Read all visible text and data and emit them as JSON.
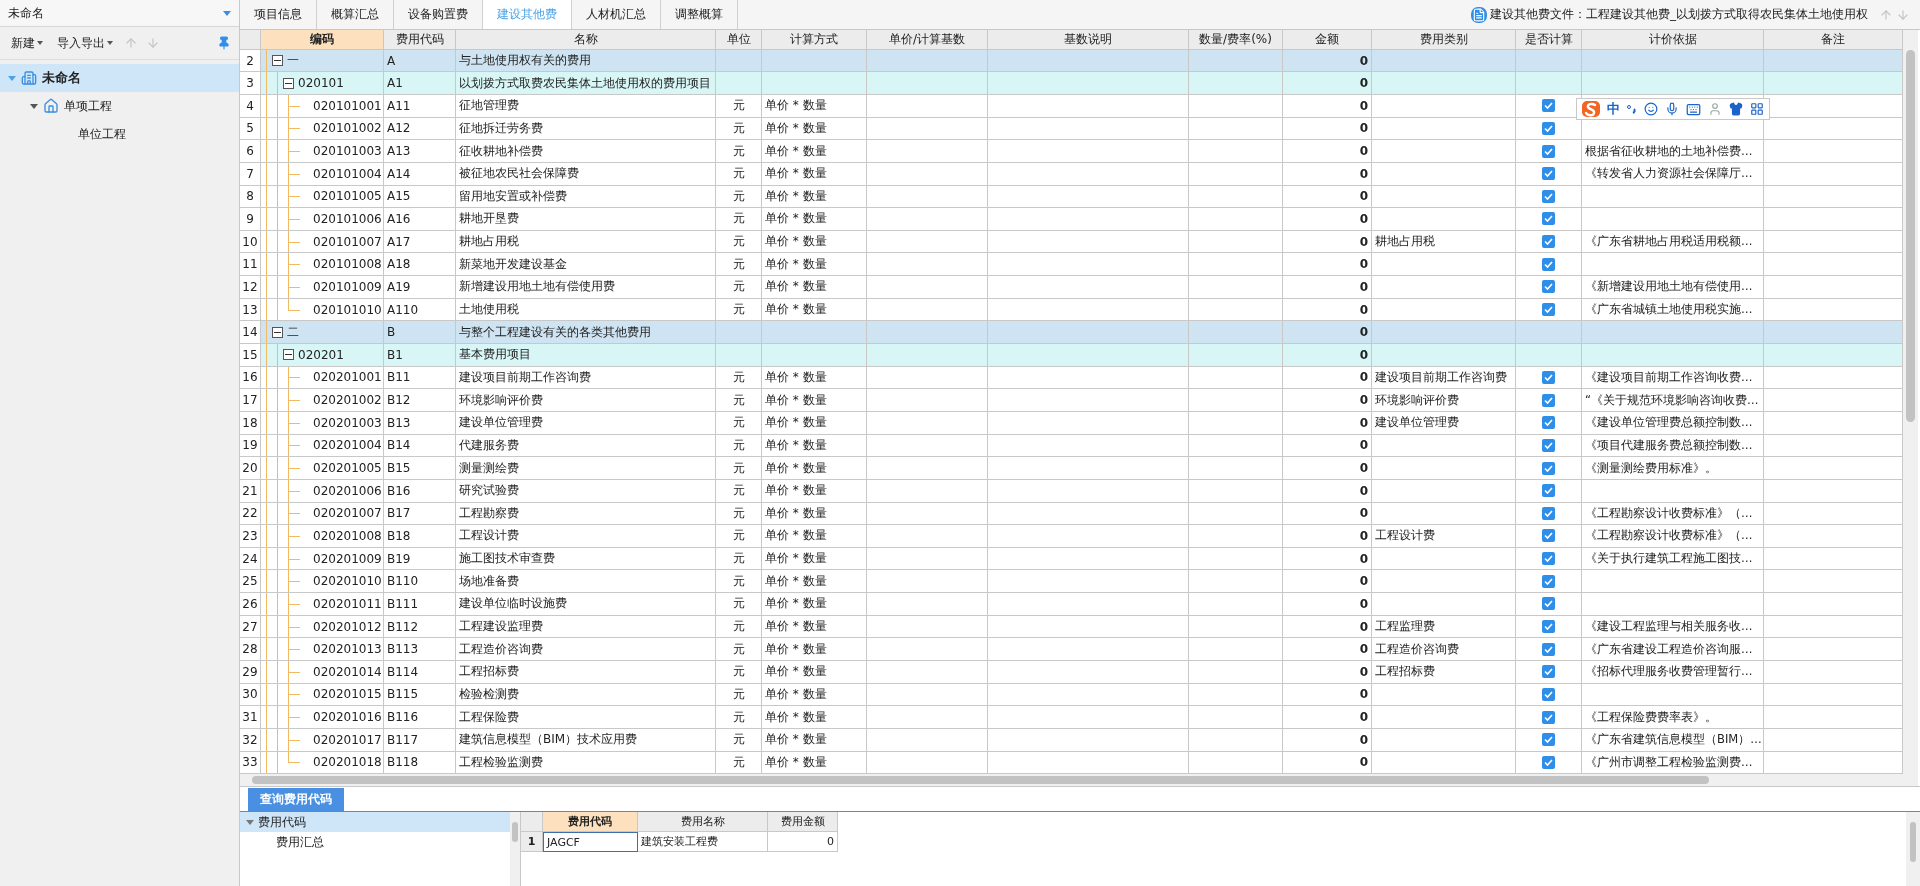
{
  "sidebar": {
    "title": "未命名",
    "toolbar": [
      {
        "label": "新建",
        "kind": "menu"
      },
      {
        "label": "导入导出",
        "kind": "menu"
      }
    ],
    "tree": [
      {
        "label": "未命名",
        "kind": "project",
        "selected": true,
        "expanded": true,
        "children": [
          {
            "label": "单项工程",
            "kind": "single",
            "selected": false,
            "expanded": true,
            "children": [
              {
                "label": "单位工程",
                "selected": false
              }
            ]
          }
        ]
      }
    ]
  },
  "tabs": [
    {
      "label": "项目信息",
      "selected": false
    },
    {
      "label": "概算汇总",
      "selected": false
    },
    {
      "label": "设备购置费",
      "selected": false
    },
    {
      "label": "建设其他费",
      "selected": true
    },
    {
      "label": "人材机汇总",
      "selected": false
    },
    {
      "label": "调整概算",
      "selected": false
    }
  ],
  "file_info": "建设其他费文件：工程建设其他费_以划拨方式取得农民集体土地使用权",
  "table": {
    "columns": [
      {
        "label": "编码",
        "selected": true
      },
      {
        "label": "费用代码",
        "selected": false
      },
      {
        "label": "名称",
        "selected": false
      },
      {
        "label": "单位",
        "selected": false
      },
      {
        "label": "计算方式",
        "selected": false
      },
      {
        "label": "单价/计算基数",
        "selected": false
      },
      {
        "label": "基数说明",
        "selected": false
      },
      {
        "label": "数量/费率(%)",
        "selected": false
      },
      {
        "label": "金额",
        "selected": false
      },
      {
        "label": "费用类别",
        "selected": false
      },
      {
        "label": "是否计算",
        "selected": false
      },
      {
        "label": "计价依据",
        "selected": false
      },
      {
        "label": "备注",
        "selected": false
      }
    ],
    "rows": [
      {
        "kind": "group",
        "no": "2",
        "code": "一",
        "fee_code": "A",
        "name": "与土地使用权有关的费用",
        "amount": "0",
        "expanded": true,
        "children": [
          {
            "kind": "subgroup",
            "no": "3",
            "code": "020101",
            "fee_code": "A1",
            "name": "以划拨方式取费农民集体土地使用权的费用项目",
            "amount": "0",
            "expanded": true,
            "children": [
              {
                "kind": "item",
                "no": "4",
                "code": "020101001",
                "fee_code": "A11",
                "name": "征地管理费",
                "unit": "元",
                "method": "单价 * 数量",
                "amount": "0",
                "checked": true
              },
              {
                "kind": "item",
                "no": "5",
                "code": "020101002",
                "fee_code": "A12",
                "name": "征地拆迁劳务费",
                "unit": "元",
                "method": "单价 * 数量",
                "amount": "0",
                "checked": true
              },
              {
                "kind": "item",
                "no": "6",
                "code": "020101003",
                "fee_code": "A13",
                "name": "征收耕地补偿费",
                "unit": "元",
                "method": "单价 * 数量",
                "amount": "0",
                "checked": true,
                "basis": "根据省征收耕地的土地补偿费…"
              },
              {
                "kind": "item",
                "no": "7",
                "code": "020101004",
                "fee_code": "A14",
                "name": "被征地农民社会保障费",
                "unit": "元",
                "method": "单价 * 数量",
                "amount": "0",
                "checked": true,
                "basis": "《转发省人力资源社会保障厅…"
              },
              {
                "kind": "item",
                "no": "8",
                "code": "020101005",
                "fee_code": "A15",
                "name": "留用地安置或补偿费",
                "unit": "元",
                "method": "单价 * 数量",
                "amount": "0",
                "checked": true
              },
              {
                "kind": "item",
                "no": "9",
                "code": "020101006",
                "fee_code": "A16",
                "name": "耕地开垦费",
                "unit": "元",
                "method": "单价 * 数量",
                "amount": "0",
                "checked": true
              },
              {
                "kind": "item",
                "no": "10",
                "code": "020101007",
                "fee_code": "A17",
                "name": "耕地占用税",
                "unit": "元",
                "method": "单价 * 数量",
                "amount": "0",
                "category": "耕地占用税",
                "checked": true,
                "basis": "《广东省耕地占用税适用税额…"
              },
              {
                "kind": "item",
                "no": "11",
                "code": "020101008",
                "fee_code": "A18",
                "name": "新菜地开发建设基金",
                "unit": "元",
                "method": "单价 * 数量",
                "amount": "0",
                "checked": true
              },
              {
                "kind": "item",
                "no": "12",
                "code": "020101009",
                "fee_code": "A19",
                "name": "新增建设用地土地有偿使用费",
                "unit": "元",
                "method": "单价 * 数量",
                "amount": "0",
                "checked": true,
                "basis": "《新增建设用地土地有偿使用…"
              },
              {
                "kind": "item",
                "no": "13",
                "code": "020101010",
                "fee_code": "A110",
                "name": "土地使用税",
                "unit": "元",
                "method": "单价 * 数量",
                "amount": "0",
                "checked": true,
                "basis": "《广东省城镇土地使用税实施…"
              }
            ]
          }
        ]
      },
      {
        "kind": "group",
        "no": "14",
        "code": "二",
        "fee_code": "B",
        "name": "与整个工程建设有关的各类其他费用",
        "amount": "0",
        "expanded": true,
        "children": [
          {
            "kind": "subgroup",
            "no": "15",
            "code": "020201",
            "fee_code": "B1",
            "name": "基本费用项目",
            "amount": "0",
            "expanded": true,
            "children": [
              {
                "kind": "item",
                "no": "16",
                "code": "020201001",
                "fee_code": "B11",
                "name": "建设项目前期工作咨询费",
                "unit": "元",
                "method": "单价 * 数量",
                "amount": "0",
                "category": "建设项目前期工作咨询费",
                "checked": true,
                "basis": "《建设项目前期工作咨询收费…"
              },
              {
                "kind": "item",
                "no": "17",
                "code": "020201002",
                "fee_code": "B12",
                "name": "环境影响评价费",
                "unit": "元",
                "method": "单价 * 数量",
                "amount": "0",
                "category": "环境影响评价费",
                "checked": true,
                "basis": "“《关于规范环境影响咨询收费…"
              },
              {
                "kind": "item",
                "no": "18",
                "code": "020201003",
                "fee_code": "B13",
                "name": "建设单位管理费",
                "unit": "元",
                "method": "单价 * 数量",
                "amount": "0",
                "category": "建设单位管理费",
                "checked": true,
                "basis": "《建设单位管理费总额控制数…"
              },
              {
                "kind": "item",
                "no": "19",
                "code": "020201004",
                "fee_code": "B14",
                "name": "代建服务费",
                "unit": "元",
                "method": "单价 * 数量",
                "amount": "0",
                "checked": true,
                "basis": "《项目代建服务费总额控制数…"
              },
              {
                "kind": "item",
                "no": "20",
                "code": "020201005",
                "fee_code": "B15",
                "name": "测量测绘费",
                "unit": "元",
                "method": "单价 * 数量",
                "amount": "0",
                "checked": true,
                "basis": "《测量测绘费用标准》。"
              },
              {
                "kind": "item",
                "no": "21",
                "code": "020201006",
                "fee_code": "B16",
                "name": "研究试验费",
                "unit": "元",
                "method": "单价 * 数量",
                "amount": "0",
                "checked": true
              },
              {
                "kind": "item",
                "no": "22",
                "code": "020201007",
                "fee_code": "B17",
                "name": "工程勘察费",
                "unit": "元",
                "method": "单价 * 数量",
                "amount": "0",
                "checked": true,
                "basis": "《工程勘察设计收费标准》（…"
              },
              {
                "kind": "item",
                "no": "23",
                "code": "020201008",
                "fee_code": "B18",
                "name": "工程设计费",
                "unit": "元",
                "method": "单价 * 数量",
                "amount": "0",
                "category": "工程设计费",
                "checked": true,
                "basis": "《工程勘察设计收费标准》（…"
              },
              {
                "kind": "item",
                "no": "24",
                "code": "020201009",
                "fee_code": "B19",
                "name": "施工图技术审查费",
                "unit": "元",
                "method": "单价 * 数量",
                "amount": "0",
                "checked": true,
                "basis": "《关于执行建筑工程施工图技…"
              },
              {
                "kind": "item",
                "no": "25",
                "code": "020201010",
                "fee_code": "B110",
                "name": "场地准备费",
                "unit": "元",
                "method": "单价 * 数量",
                "amount": "0",
                "checked": true
              },
              {
                "kind": "item",
                "no": "26",
                "code": "020201011",
                "fee_code": "B111",
                "name": "建设单位临时设施费",
                "unit": "元",
                "method": "单价 * 数量",
                "amount": "0",
                "checked": true
              },
              {
                "kind": "item",
                "no": "27",
                "code": "020201012",
                "fee_code": "B112",
                "name": "工程建设监理费",
                "unit": "元",
                "method": "单价 * 数量",
                "amount": "0",
                "category": "工程监理费",
                "checked": true,
                "basis": "《建设工程监理与相关服务收…"
              },
              {
                "kind": "item",
                "no": "28",
                "code": "020201013",
                "fee_code": "B113",
                "name": "工程造价咨询费",
                "unit": "元",
                "method": "单价 * 数量",
                "amount": "0",
                "category": "工程造价咨询费",
                "checked": true,
                "basis": "《广东省建设工程造价咨询服…"
              },
              {
                "kind": "item",
                "no": "29",
                "code": "020201014",
                "fee_code": "B114",
                "name": "工程招标费",
                "unit": "元",
                "method": "单价 * 数量",
                "amount": "0",
                "category": "工程招标费",
                "checked": true,
                "basis": "《招标代理服务收费管理暂行…"
              },
              {
                "kind": "item",
                "no": "30",
                "code": "020201015",
                "fee_code": "B115",
                "name": "检验检测费",
                "unit": "元",
                "method": "单价 * 数量",
                "amount": "0",
                "checked": true
              },
              {
                "kind": "item",
                "no": "31",
                "code": "020201016",
                "fee_code": "B116",
                "name": "工程保险费",
                "unit": "元",
                "method": "单价 * 数量",
                "amount": "0",
                "checked": true,
                "basis": "《工程保险费费率表》。"
              },
              {
                "kind": "item",
                "no": "32",
                "code": "020201017",
                "fee_code": "B117",
                "name": "建筑信息模型（BIM）技术应用费",
                "unit": "元",
                "method": "单价 * 数量",
                "amount": "0",
                "checked": true,
                "basis": "《广东省建筑信息模型（BIM）…"
              },
              {
                "kind": "item",
                "no": "33",
                "code": "020201018",
                "fee_code": "B118",
                "name": "工程检验监测费",
                "unit": "元",
                "method": "单价 * 数量",
                "amount": "0",
                "checked": true,
                "basis": "《广州市调整工程检验监测费…"
              }
            ]
          }
        ]
      }
    ]
  },
  "ime_toolbar": {
    "mode": "中"
  },
  "bottom_panel": {
    "tab": "查询费用代码",
    "tree": [
      {
        "label": "费用代码",
        "selected": true,
        "expanded": true,
        "children": [
          {
            "label": "费用汇总",
            "selected": false
          }
        ]
      }
    ],
    "table": {
      "columns": [
        {
          "label": "费用代码",
          "selected": true
        },
        {
          "label": "费用名称",
          "selected": false
        },
        {
          "label": "费用金额",
          "selected": false
        }
      ],
      "rows": [
        {
          "no": "1",
          "code": "JAGCF",
          "name": "建筑安装工程费",
          "amount": "0"
        }
      ]
    }
  }
}
